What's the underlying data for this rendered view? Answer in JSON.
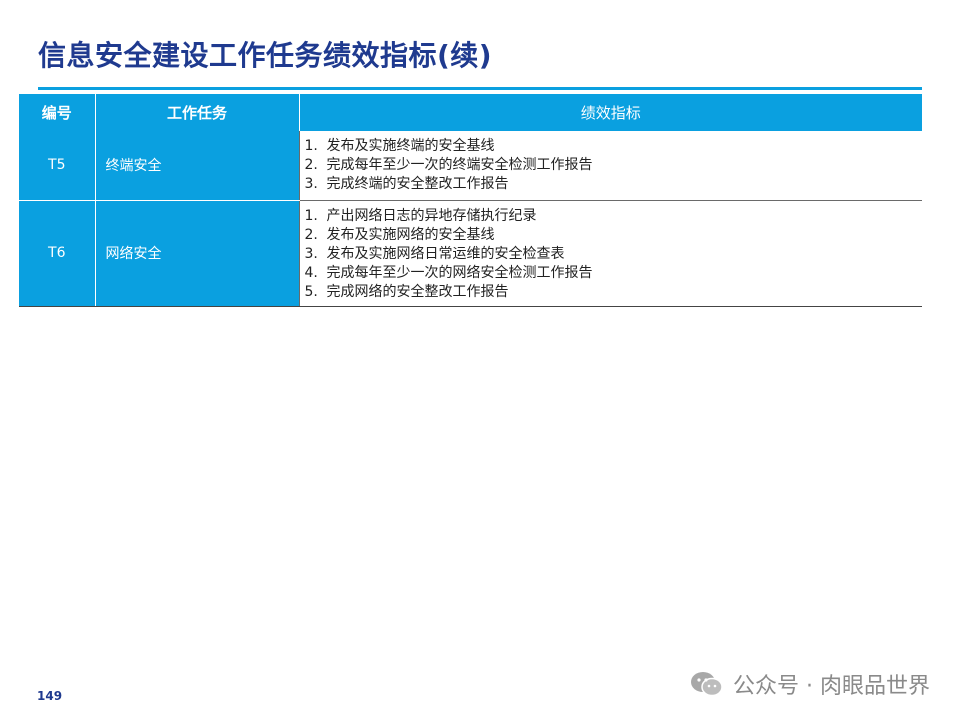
{
  "page": {
    "title": "信息安全建设工作任务绩效指标(续)",
    "page_number": "149",
    "accent_color": "#0aa0e0",
    "title_color": "#1f3a8f"
  },
  "table": {
    "headers": [
      "编号",
      "工作任务",
      "绩效指标"
    ],
    "rows": [
      {
        "id": "T5",
        "task": "终端安全",
        "kpis": [
          {
            "num": "1.",
            "text": "发布及实施终端的安全基线"
          },
          {
            "num": "2.",
            "text": "完成每年至少一次的终端安全检测工作报告"
          },
          {
            "num": "3.",
            "text": "完成终端的安全整改工作报告"
          }
        ]
      },
      {
        "id": "T6",
        "task": "网络安全",
        "kpis": [
          {
            "num": "1.",
            "text": "产出网络日志的异地存储执行纪录"
          },
          {
            "num": "2.",
            "text": "发布及实施网络的安全基线"
          },
          {
            "num": "3.",
            "text": "发布及实施网络日常运维的安全检查表"
          },
          {
            "num": "4.",
            "text": "完成每年至少一次的网络安全检测工作报告"
          },
          {
            "num": "5.",
            "text": "完成网络的安全整改工作报告"
          }
        ]
      }
    ]
  },
  "watermark": {
    "icon": "wechat-icon",
    "text": "公众号 · 肉眼品世界"
  }
}
